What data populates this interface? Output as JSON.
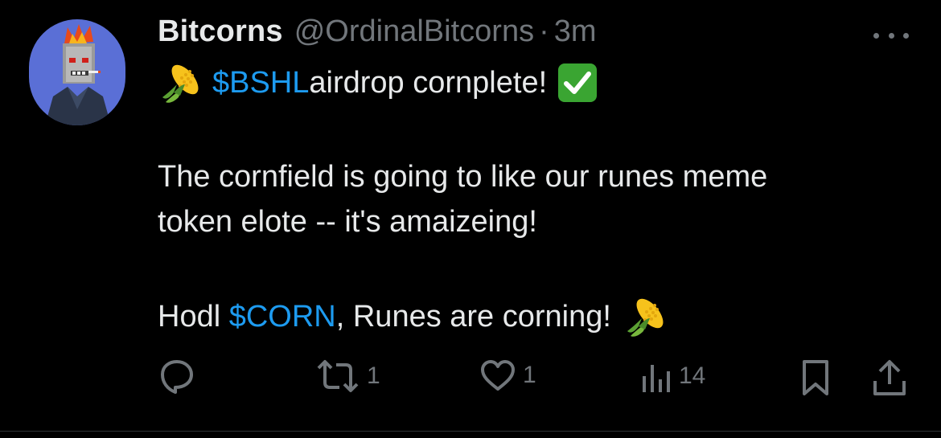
{
  "tweet": {
    "author_name": "Bitcorns",
    "handle": "@OrdinalBitcorns",
    "separator": "·",
    "time": "3m",
    "line1_cashtag": "$BSHL",
    "line1_text": " airdrop cornplete!",
    "line2": "The cornfield is going to like our runes meme",
    "line3": "token elote -- it's amaizeing!",
    "line4_prefix": "Hodl ",
    "line4_cashtag": "$CORN",
    "line4_text": ", Runes are corning!"
  },
  "actions": {
    "reply_count": "",
    "retweet_count": "1",
    "like_count": "1",
    "views_count": "14"
  },
  "colors": {
    "background": "#000000",
    "text": "#e7e9ea",
    "muted": "#71767b",
    "link": "#1d9bf0",
    "check_green": "#3aa532"
  },
  "icons": [
    "more-icon",
    "corn-emoji",
    "check-mark-emoji",
    "reply-icon",
    "retweet-icon",
    "like-icon",
    "views-icon",
    "bookmark-icon",
    "share-icon"
  ]
}
